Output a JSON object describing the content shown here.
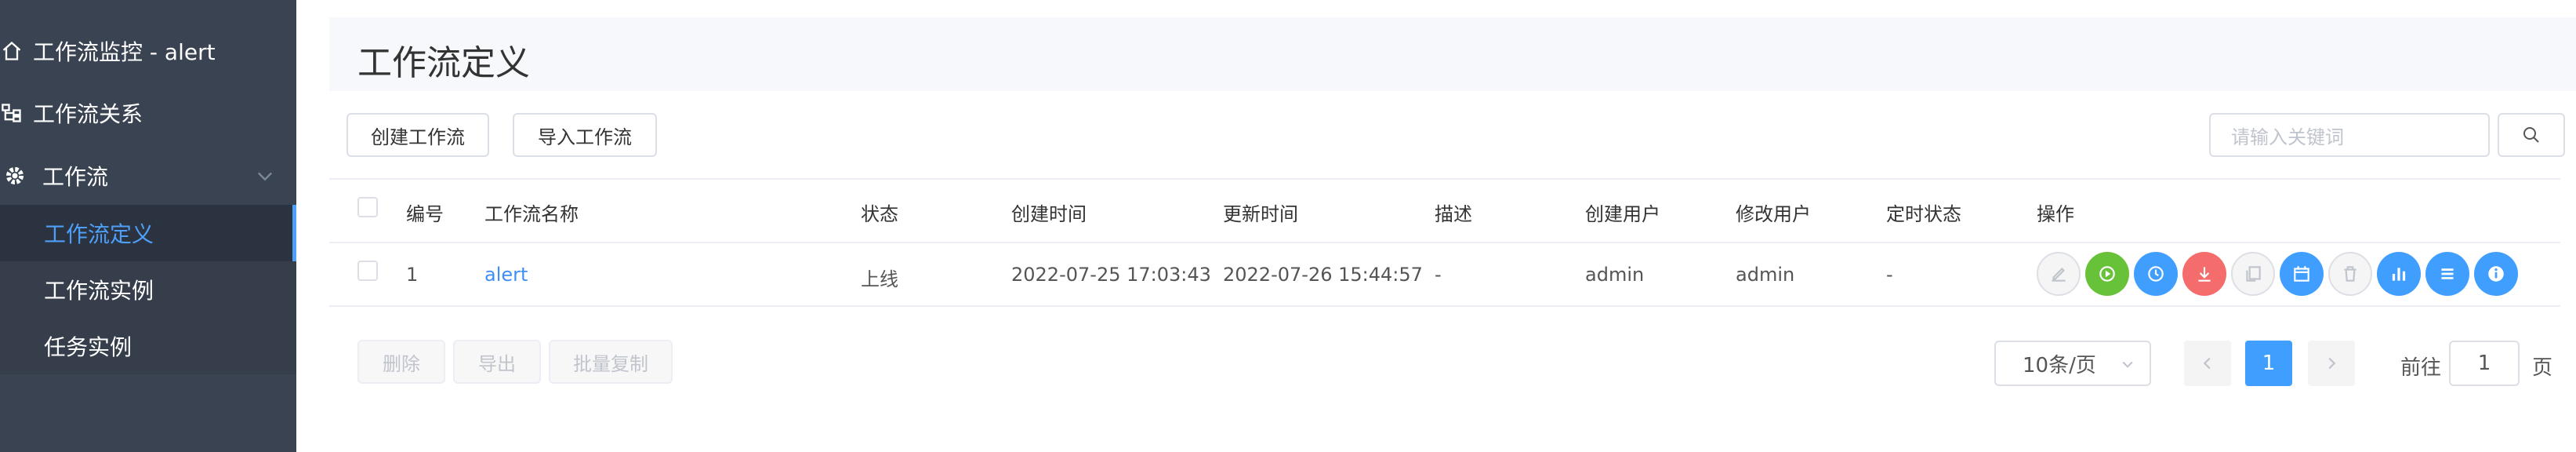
{
  "sidebar": {
    "items": [
      {
        "label": "工作流监控 - alert",
        "icon": "home-icon"
      },
      {
        "label": "工作流关系",
        "icon": "relation-tree-icon"
      },
      {
        "label": "工作流",
        "icon": "gear-icon"
      }
    ],
    "sub_items": [
      {
        "label": "工作流定义",
        "active": true
      },
      {
        "label": "工作流实例",
        "active": false
      },
      {
        "label": "任务实例",
        "active": false
      }
    ]
  },
  "page": {
    "title": "工作流定义"
  },
  "toolbar": {
    "create_label": "创建工作流",
    "import_label": "导入工作流",
    "search_placeholder": "请输入关键词"
  },
  "table": {
    "headers": [
      "编号",
      "工作流名称",
      "状态",
      "创建时间",
      "更新时间",
      "描述",
      "创建用户",
      "修改用户",
      "定时状态",
      "操作"
    ],
    "rows": [
      {
        "id": "1",
        "name": "alert",
        "status": "上线",
        "created": "2022-07-25 17:03:43",
        "updated": "2022-07-26 15:44:57",
        "desc": "-",
        "creator": "admin",
        "modifier": "admin",
        "schedule": "-"
      }
    ],
    "operations": [
      {
        "icon": "edit-icon",
        "color": "gray"
      },
      {
        "icon": "run-icon",
        "color": "#67c23a"
      },
      {
        "icon": "timing-icon",
        "color": "#409eff"
      },
      {
        "icon": "offline-icon",
        "color": "#f56c6c"
      },
      {
        "icon": "copy-icon",
        "color": "gray"
      },
      {
        "icon": "schedule-calendar-icon",
        "color": "#409eff"
      },
      {
        "icon": "delete-icon",
        "color": "gray"
      },
      {
        "icon": "tree-view-icon",
        "color": "#409eff"
      },
      {
        "icon": "version-list-icon",
        "color": "#409eff"
      },
      {
        "icon": "info-icon",
        "color": "#409eff"
      }
    ]
  },
  "footer": {
    "delete_label": "删除",
    "export_label": "导出",
    "batch_copy_label": "批量复制"
  },
  "pagination": {
    "page_size": "10条/页",
    "current_page": "1",
    "goto_prefix": "前往",
    "goto_value": "1",
    "goto_suffix": "页"
  }
}
